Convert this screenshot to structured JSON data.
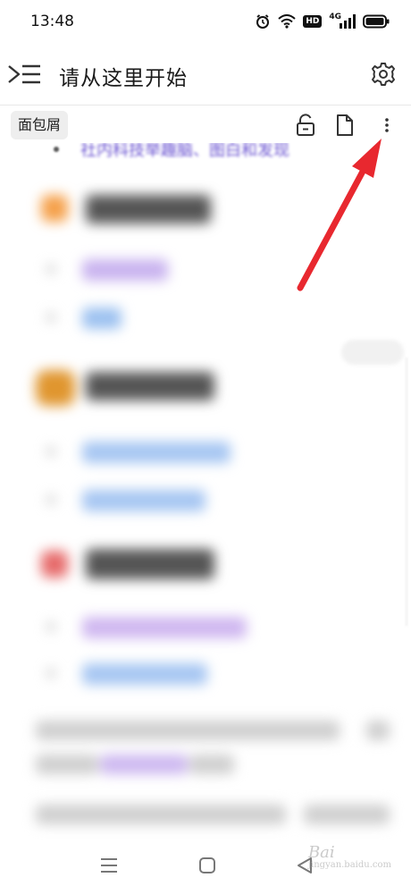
{
  "status_bar": {
    "time": "13:48",
    "icons": [
      "alarm-icon",
      "wifi-icon",
      "hd-icon",
      "signal-icon",
      "battery-icon"
    ],
    "hd_label": "HD",
    "network_label": "4G"
  },
  "header": {
    "title": "请从这里开始",
    "menu_icon": "sidebar-toggle-icon",
    "settings_icon": "gear-icon"
  },
  "toolbar": {
    "breadcrumb_label": "面包屑",
    "icons": [
      "unlock-icon",
      "page-icon",
      "more-vertical-icon"
    ]
  },
  "content": {
    "top_line": "社内科技举趣脑、图白和发现"
  },
  "colors": {
    "arrow": "#e8282f",
    "link_purple": "#6a53d1",
    "link_blue": "#4a8be0"
  },
  "watermark": {
    "brand": "Bai",
    "sub": "jingyan.baidu.com"
  },
  "nav_bar": {
    "icons": [
      "menu-lines-icon",
      "home-square-icon",
      "back-triangle-icon"
    ]
  }
}
